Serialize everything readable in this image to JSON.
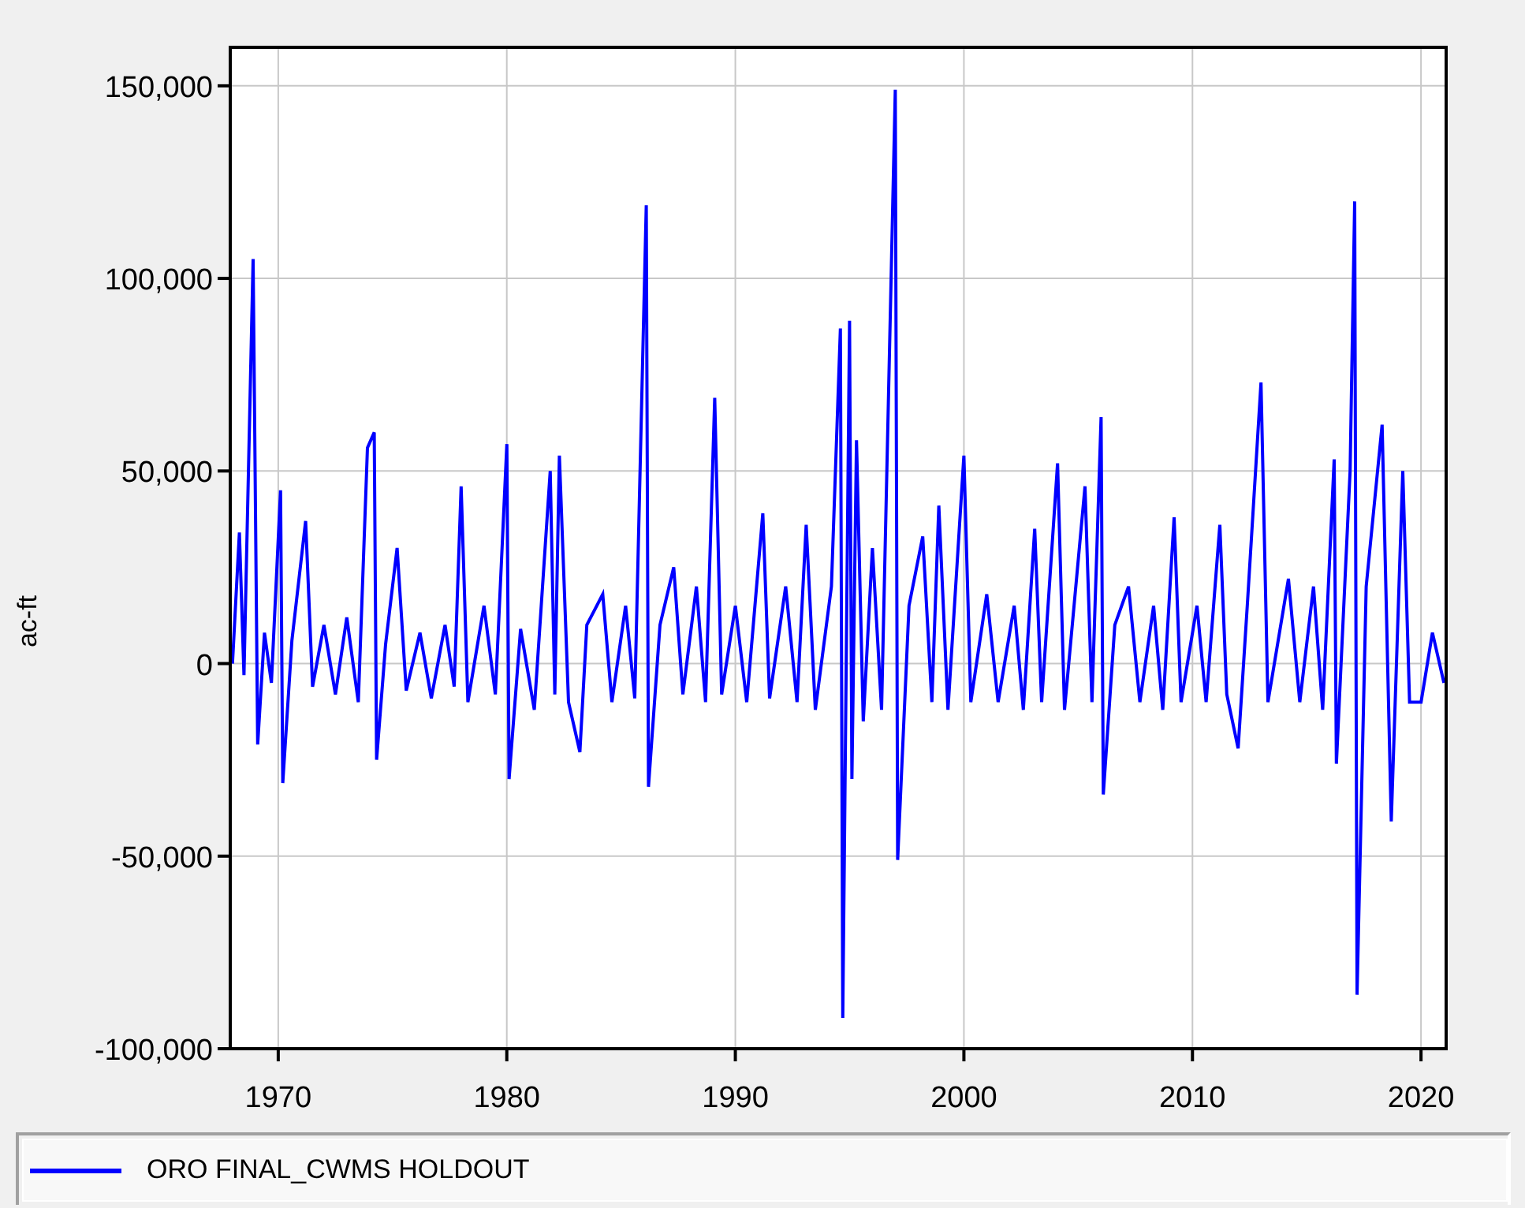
{
  "chart": {
    "chart_data": {
      "type": "line",
      "grid": true,
      "ylabel": "ac-ft",
      "xlim": [
        1967.9,
        2021.1
      ],
      "ylim": [
        -100000,
        160000
      ],
      "xticks": [
        {
          "value": 1970,
          "label": "1970"
        },
        {
          "value": 1980,
          "label": "1980"
        },
        {
          "value": 1990,
          "label": "1990"
        },
        {
          "value": 2000,
          "label": "2000"
        },
        {
          "value": 2010,
          "label": "2010"
        },
        {
          "value": 2020,
          "label": "2020"
        }
      ],
      "yticks": [
        {
          "value": 150000,
          "label": "150,000"
        },
        {
          "value": 100000,
          "label": "100,000"
        },
        {
          "value": 50000,
          "label": "50,000"
        },
        {
          "value": 0,
          "label": "0"
        },
        {
          "value": -50000,
          "label": "-50,000"
        },
        {
          "value": -100000,
          "label": "-100,000"
        }
      ],
      "x": [
        1968.0,
        1968.3,
        1968.5,
        1968.9,
        1969.1,
        1969.4,
        1969.7,
        1970.1,
        1970.2,
        1970.6,
        1971.2,
        1971.5,
        1972.0,
        1972.5,
        1973.0,
        1973.5,
        1973.9,
        1974.2,
        1974.3,
        1974.7,
        1975.2,
        1975.6,
        1976.2,
        1976.7,
        1977.3,
        1977.7,
        1978.0,
        1978.3,
        1979.0,
        1979.5,
        1980.0,
        1980.1,
        1980.6,
        1981.2,
        1981.9,
        1982.1,
        1982.3,
        1982.7,
        1983.2,
        1983.5,
        1984.2,
        1984.6,
        1985.2,
        1985.6,
        1986.1,
        1986.2,
        1986.7,
        1987.3,
        1987.7,
        1988.3,
        1988.7,
        1989.1,
        1989.4,
        1990.0,
        1990.5,
        1991.2,
        1991.5,
        1992.2,
        1992.7,
        1993.1,
        1993.5,
        1994.2,
        1994.6,
        1994.7,
        1995.0,
        1995.1,
        1995.3,
        1995.6,
        1996.0,
        1996.4,
        1997.0,
        1997.1,
        1997.6,
        1998.2,
        1998.6,
        1998.9,
        1999.3,
        2000.0,
        2000.3,
        2001.0,
        2001.5,
        2002.2,
        2002.6,
        2003.1,
        2003.4,
        2004.1,
        2004.4,
        2005.3,
        2005.6,
        2006.0,
        2006.1,
        2006.6,
        2007.2,
        2007.7,
        2008.3,
        2008.7,
        2009.2,
        2009.5,
        2010.2,
        2010.6,
        2011.2,
        2011.5,
        2012.0,
        2012.4,
        2013.0,
        2013.3,
        2014.2,
        2014.7,
        2015.3,
        2015.7,
        2016.2,
        2016.3,
        2016.9,
        2017.1,
        2017.2,
        2017.6,
        2018.3,
        2018.7,
        2019.2,
        2019.5,
        2020.0,
        2020.5,
        2021.0
      ],
      "series": [
        {
          "name": "ORO FINAL_CWMS HOLDOUT",
          "color": "#0000ff",
          "values": [
            0,
            34000,
            -3000,
            105000,
            -21000,
            8000,
            -5000,
            45000,
            -31000,
            6000,
            37000,
            -6000,
            10000,
            -8000,
            12000,
            -10000,
            56000,
            60000,
            -25000,
            5000,
            30000,
            -7000,
            8000,
            -9000,
            10000,
            -6000,
            46000,
            -10000,
            15000,
            -8000,
            57000,
            -30000,
            9000,
            -12000,
            50000,
            -8000,
            54000,
            -10000,
            -23000,
            10000,
            18000,
            -10000,
            15000,
            -9000,
            119000,
            -32000,
            10000,
            25000,
            -8000,
            20000,
            -10000,
            69000,
            -8000,
            15000,
            -10000,
            39000,
            -9000,
            20000,
            -10000,
            36000,
            -12000,
            20000,
            87000,
            -92000,
            89000,
            -30000,
            58000,
            -15000,
            30000,
            -12000,
            149000,
            -51000,
            15000,
            33000,
            -10000,
            41000,
            -12000,
            54000,
            -10000,
            18000,
            -10000,
            15000,
            -12000,
            35000,
            -10000,
            52000,
            -12000,
            46000,
            -10000,
            64000,
            -34000,
            10000,
            20000,
            -10000,
            15000,
            -12000,
            38000,
            -10000,
            15000,
            -10000,
            36000,
            -8000,
            -22000,
            15000,
            73000,
            -10000,
            22000,
            -10000,
            20000,
            -12000,
            53000,
            -26000,
            50000,
            120000,
            -86000,
            20000,
            62000,
            -41000,
            50000,
            -10000,
            -10000,
            8000,
            -5000
          ]
        }
      ]
    }
  }
}
